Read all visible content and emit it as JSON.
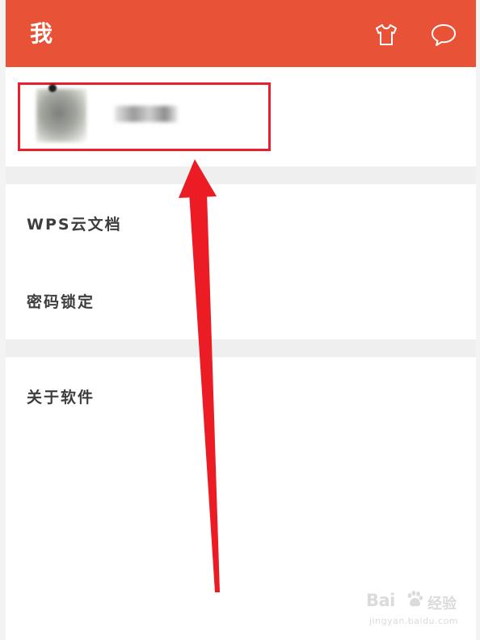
{
  "colors": {
    "accent": "#e85338",
    "highlight": "#e8202e",
    "arrow": "#ec1c24"
  },
  "header": {
    "title": "我",
    "icons": [
      "tshirt-icon",
      "chat-bubble-icon"
    ]
  },
  "profile": {
    "nickname": ""
  },
  "menu": {
    "group1": [
      {
        "label": "WPS云文档"
      },
      {
        "label": "密码锁定"
      }
    ],
    "group2": [
      {
        "label": "关于软件"
      }
    ]
  },
  "watermark": {
    "logo_text": "Bai",
    "logo_suffix": "经验",
    "url": "jingyan.baidu.com"
  }
}
